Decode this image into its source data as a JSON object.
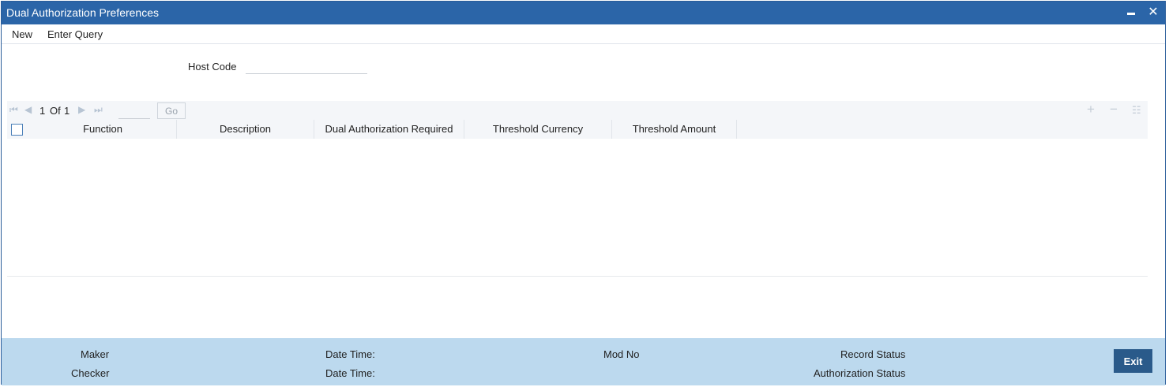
{
  "window": {
    "title": "Dual Authorization Preferences",
    "minimize_icon": "minimize-icon",
    "close_icon": "close-icon",
    "accent": "#2b65a8"
  },
  "menu": {
    "new_label": "New",
    "enter_query_label": "Enter Query"
  },
  "form": {
    "host_code_label": "Host Code",
    "host_code_value": ""
  },
  "grid": {
    "pagination": {
      "current": "1",
      "of_label": "Of",
      "total": "1",
      "go_label": "Go",
      "page_input_value": ""
    },
    "toolbar_icons": [
      "add-row-icon",
      "delete-row-icon",
      "column-settings-icon"
    ],
    "columns": [
      "Function",
      "Description",
      "Dual Authorization Required",
      "Threshold Currency",
      "Threshold Amount"
    ],
    "rows": []
  },
  "footer": {
    "maker_label": "Maker",
    "checker_label": "Checker",
    "date_time_label_1": "Date Time:",
    "date_time_label_2": "Date Time:",
    "mod_no_label": "Mod No",
    "record_status_label": "Record Status",
    "authorization_status_label": "Authorization Status",
    "exit_label": "Exit",
    "background": "#bcd9ee",
    "exit_color": "#2a5a8a"
  }
}
